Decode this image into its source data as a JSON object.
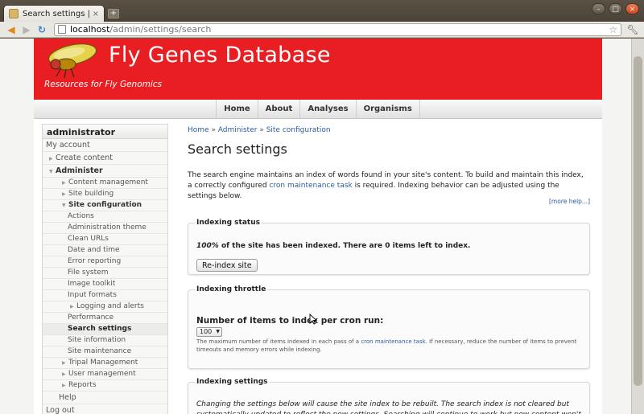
{
  "browser": {
    "tab_title": "Search settings | Fly ...",
    "tab_close": "×",
    "new_tab": "+",
    "url_host": "localhost",
    "url_path": "/admin/settings/search",
    "window_controls": [
      "–",
      "□",
      "×"
    ]
  },
  "site": {
    "name": "Fly Genes Database",
    "slogan": "Resources for Fly Genomics",
    "brand_color": "#e81e23"
  },
  "primary_nav": [
    "Home",
    "About",
    "Analyses",
    "Organisms"
  ],
  "sidebar": {
    "title": "administrator",
    "items": [
      {
        "label": "My account",
        "level": 0,
        "arrow": ""
      },
      {
        "label": "Create content",
        "level": 1,
        "arrow": "▶"
      },
      {
        "label": "Administer",
        "level": 1,
        "arrow": "▼",
        "bold": true
      },
      {
        "label": "Content management",
        "level": 2,
        "arrow": "▶"
      },
      {
        "label": "Site building",
        "level": 2,
        "arrow": "▶"
      },
      {
        "label": "Site configuration",
        "level": 2,
        "arrow": "▼",
        "bold": true
      },
      {
        "label": "Actions",
        "level": 3,
        "arrow": ""
      },
      {
        "label": "Administration theme",
        "level": 3,
        "arrow": ""
      },
      {
        "label": "Clean URLs",
        "level": 3,
        "arrow": ""
      },
      {
        "label": "Date and time",
        "level": 3,
        "arrow": ""
      },
      {
        "label": "Error reporting",
        "level": 3,
        "arrow": ""
      },
      {
        "label": "File system",
        "level": 3,
        "arrow": ""
      },
      {
        "label": "Image toolkit",
        "level": 3,
        "arrow": ""
      },
      {
        "label": "Input formats",
        "level": 3,
        "arrow": ""
      },
      {
        "label": "Logging and alerts",
        "level": 4,
        "arrow": "▶"
      },
      {
        "label": "Performance",
        "level": 3,
        "arrow": ""
      },
      {
        "label": "Search settings",
        "level": 3,
        "arrow": "",
        "active": true
      },
      {
        "label": "Site information",
        "level": 3,
        "arrow": ""
      },
      {
        "label": "Site maintenance",
        "level": 3,
        "arrow": ""
      },
      {
        "label": "Tripal Management",
        "level": 2,
        "arrow": "▶"
      },
      {
        "label": "User management",
        "level": 2,
        "arrow": "▶"
      },
      {
        "label": "Reports",
        "level": 2,
        "arrow": "▶"
      },
      {
        "label": "Help",
        "level": 1,
        "arrow": "",
        "indent_plain": true
      },
      {
        "label": "Log out",
        "level": 0,
        "arrow": ""
      }
    ]
  },
  "content": {
    "breadcrumb": [
      "Home",
      "Administer",
      "Site configuration"
    ],
    "breadcrumb_sep": " » ",
    "title": "Search settings",
    "intro_part1": "The search engine maintains an index of words found in your site's content. To build and maintain this index, a correctly configured ",
    "intro_link": "cron maintenance task",
    "intro_part2": " is required. Indexing behavior can be adjusted using the settings below.",
    "more_help": "[more help...]",
    "indexing_status": {
      "legend": "Indexing status",
      "percent": "100%",
      "status_rest": " of the site has been indexed. There are 0 items left to index.",
      "button": "Re-index site"
    },
    "indexing_throttle": {
      "legend": "Indexing throttle",
      "label": "Number of items to index per cron run:",
      "selected": "100",
      "desc_part1": "The maximum number of items indexed in each pass of a ",
      "desc_link": "cron maintenance task",
      "desc_part2": ". If necessary, reduce the number of items to prevent timeouts and memory errors while indexing."
    },
    "indexing_settings": {
      "legend": "Indexing settings",
      "desc": "Changing the settings below will cause the site index to be rebuilt. The search index is not cleared but systematically updated to reflect the new settings. Searching will continue to work but new content won't be indexed until all existing"
    }
  }
}
